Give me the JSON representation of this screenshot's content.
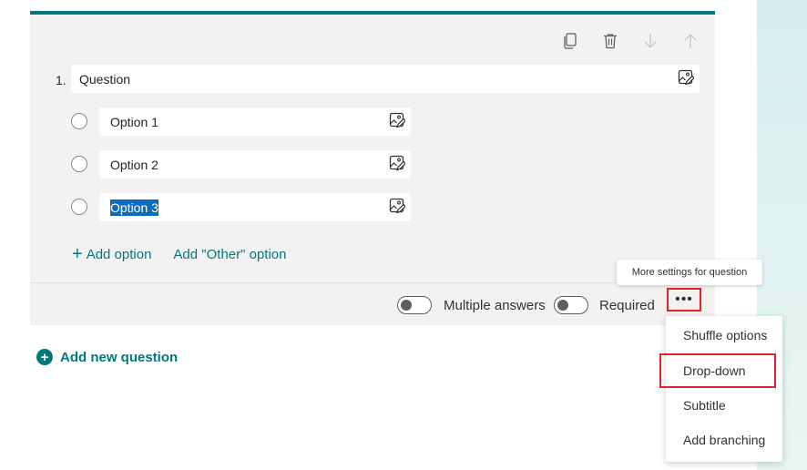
{
  "card": {
    "top_icons": [
      "copy-icon",
      "delete-icon",
      "move-down-icon",
      "move-up-icon"
    ],
    "question": {
      "number": "1.",
      "text": "Question"
    },
    "options": [
      {
        "label": "Option 1",
        "selected": false
      },
      {
        "label": "Option 2",
        "selected": false
      },
      {
        "label": "Option 3",
        "selected": true
      }
    ],
    "add_option": "Add option",
    "add_other_option": "Add \"Other\" option",
    "footer": {
      "multiple_answers_label": "Multiple answers",
      "required_label": "Required",
      "more_button": "•••"
    }
  },
  "tooltip": "More settings for question",
  "add_new_question": "Add new question",
  "menu": {
    "items": [
      "Shuffle options",
      "Drop-down",
      "Subtitle",
      "Add branching"
    ],
    "highlighted": "Drop-down"
  },
  "colors": {
    "accent": "#03787c",
    "highlight_border": "#e0242d",
    "selection": "#0f6cbd"
  }
}
